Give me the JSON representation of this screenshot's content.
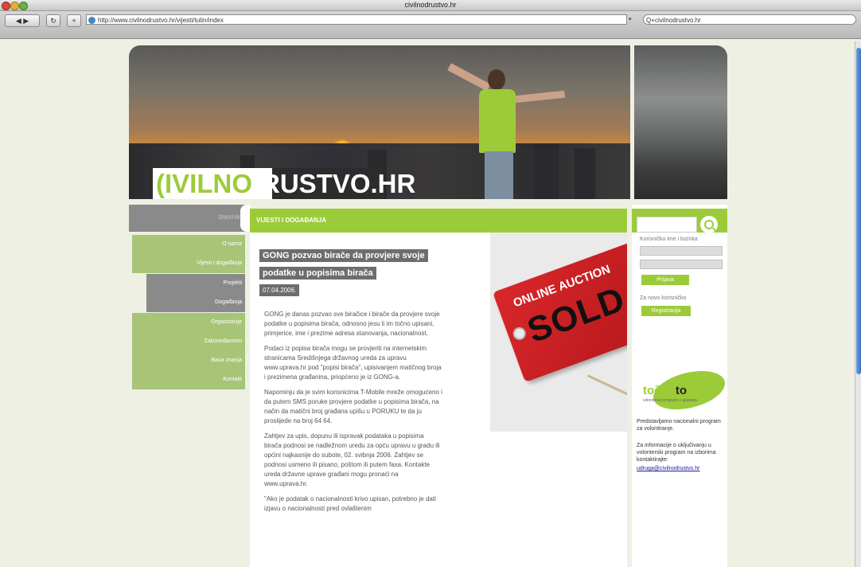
{
  "browser": {
    "window_title": "civilnodrustvo.hr",
    "back_label": "◀ ▶",
    "reload_label": "↻",
    "add_label": "+",
    "url": "http://www.civilnodrustvo.hr/vijesti/tutin/index",
    "search_value": "civilnodrustvo.hr",
    "search_prefix": "Q+"
  },
  "site": {
    "logo_green": "(IVILNO",
    "logo_white": ")RUSTVO.HR",
    "nav_header": "lzbornik",
    "nav_groups": [
      [
        "O nama",
        "Vijesti i događanja"
      ],
      [
        "Projekti",
        "Događanja"
      ],
      [
        "Organizacije",
        "Zakonodavstvo"
      ],
      [
        "Baza znanja",
        "Kontakt"
      ]
    ],
    "section_title": "VIJESTI I DOGAĐANJA",
    "article": {
      "headline": "GONG pozvao birače da provjere svoje podatke u popisima birača",
      "date": "07.04.2006.",
      "paragraphs": [
        "GONG je danas pozvao sve biračice i birače da provjere svoje podatke u popisima birača, odnosno jesu li im točno upisani, primjerice, ime i prezime adresa stanovanja, nacionalnost.",
        "Podaci iz popisa birača mogu se provjeriti na internetskim stranicama Središnjega državnog ureda za upravu www.uprava.hr pod \"popisi birača\", upisivanjem matičnog broja i prezimena građanina, priopćeno je iz GONG-a.",
        "Napominju da je svim korisnicima T-Mobile mreže omogućeno i da putem SMS poruke provjere podatke u popisima birača, na način da matični broj građana upišu u PORUKU te da ju proslijede na broj 64 64.",
        "Zahtjev za upis, dopunu ili ispravak podataka u popisima birača podnosi se nadležnom uredu za opću upravu u gradu ili općini najkasnije do subote, 02. svibnja 2006. Zahtjev se podnosi usmeno ili pisano, poštom ili putem faxa. Kontakte ureda državne uprave građani mogu pronaći na www.uprava.hr.",
        "\"Ako je podatak o nacionalnosti krivo upisan, potrebno je dati izjavu o nacionalnosti pred ovlaštenim"
      ]
    },
    "image": {
      "tag_line1": "ONLINE AUCTION",
      "tag_line2": "SOLD"
    },
    "login": {
      "user_label": "Korisničko ime i lozinka",
      "login_btn": "Prijava",
      "register_label": "Za novo korisničko",
      "register_btn": "Registracija"
    },
    "promo": {
      "logo_part1": "točno",
      "logo_part2": "to",
      "logo_sub": "volonterski program o glasanju",
      "text1": "Predstavljamo nacionalni program za volontiranje.",
      "text2": "Za informacije o uključivanju u volonterski program na izborima kontaktirajte:",
      "email": "udruga@civilnodrustvo.hr"
    }
  }
}
